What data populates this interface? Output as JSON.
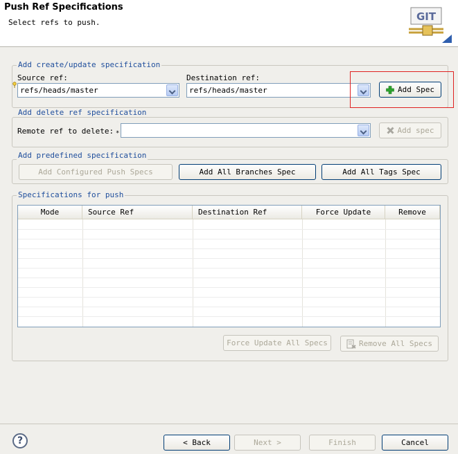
{
  "header": {
    "title": "Push Ref Specifications",
    "subtitle": "Select refs to push.",
    "logo_text": "GIT"
  },
  "create_group": {
    "title": "Add create/update specification",
    "source_label": "Source ref:",
    "source_value": "refs/heads/master",
    "dest_label": "Destination ref:",
    "dest_value": "refs/heads/master",
    "add_button": "Add Spec"
  },
  "delete_group": {
    "title": "Add delete ref specification",
    "remote_label": "Remote ref to delete:",
    "remote_value": "",
    "add_button": "Add spec"
  },
  "predefined_group": {
    "title": "Add predefined specification",
    "configured_button": "Add Configured Push Specs",
    "branches_button": "Add All Branches Spec",
    "tags_button": "Add All Tags Spec"
  },
  "specs_group": {
    "title": "Specifications for push",
    "columns": [
      "Mode",
      "Source Ref",
      "Destination Ref",
      "Force Update",
      "Remove"
    ],
    "force_all_button": "Force Update All Specs",
    "remove_all_button": "Remove All Specs"
  },
  "footer": {
    "help": "?",
    "back": "< Back",
    "next": "Next >",
    "finish": "Finish",
    "cancel": "Cancel"
  },
  "icons": {
    "help": "help-icon",
    "add": "plus-icon",
    "delete": "x-icon",
    "remove_all": "remove-icon"
  },
  "colors": {
    "group_title": "#1f4e9c",
    "highlight": "#e02020",
    "plus": "#2fa52f"
  }
}
